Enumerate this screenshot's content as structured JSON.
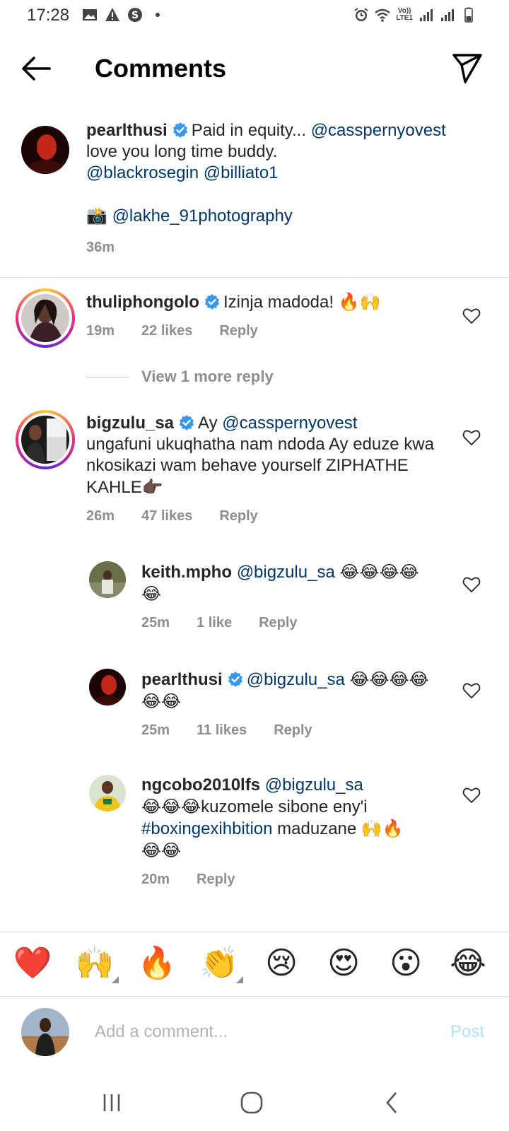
{
  "status_bar": {
    "time": "17:28",
    "network_label_top": "Vo))",
    "network_label_bottom": "LTE1"
  },
  "header": {
    "title": "Comments"
  },
  "caption": {
    "username": "pearlthusi",
    "text_start": "Paid in equity... ",
    "mention1": "@casspernyovest",
    "line2": "love you long time buddy.",
    "mention2": "@blackrosegin",
    "mention3": "@billiato1",
    "camera_emoji": "📸",
    "mention4": "@lakhe_91photography",
    "time": "36m"
  },
  "comments": [
    {
      "username": "thuliphongolo",
      "verified": true,
      "text": "Izinja madoda! ",
      "emoji": "🔥🙌",
      "time": "19m",
      "likes": "22 likes",
      "reply": "Reply"
    },
    {
      "username": "bigzulu_sa",
      "verified": true,
      "text_pre": "Ay ",
      "mention": "@casspernyovest",
      "text": "ungafuni ukuqhatha nam ndoda Ay eduze kwa nkosikazi wam behave yourself ZIPHATHE KAHLE",
      "emoji": "👉🏿",
      "time": "26m",
      "likes": "47 likes",
      "reply": "Reply"
    }
  ],
  "view_more": "View 1 more reply",
  "replies": [
    {
      "username": "keith.mpho",
      "mention": "@bigzulu_sa",
      "emoji": "😂😂😂😂😂",
      "time": "25m",
      "likes": "1 like",
      "reply": "Reply"
    },
    {
      "username": "pearlthusi",
      "verified": true,
      "mention": "@bigzulu_sa",
      "emoji": "😂😂😂😂😂😂",
      "time": "25m",
      "likes": "11 likes",
      "reply": "Reply"
    },
    {
      "username": "ngcobo2010lfs",
      "mention": "@bigzulu_sa",
      "emoji_a": "😂😂😂",
      "text_a": "kuzomele sibone eny'i",
      "hashtag": "#boxingexihbition",
      "text_b": " maduzane ",
      "emoji_b": "🙌🔥",
      "emoji_c": "😂😂",
      "time": "20m",
      "reply": "Reply"
    }
  ],
  "reaction_emojis": [
    "❤️",
    "🙌",
    "🔥",
    "👏",
    "😢",
    "😍",
    "😮",
    "😂"
  ],
  "composer": {
    "placeholder": "Add a comment...",
    "post_label": "Post"
  },
  "colors": {
    "mention": "#00376b",
    "meta_gray": "#8e8e8e",
    "verified_blue": "#3897f0",
    "post_disabled": "#b2dffc"
  }
}
